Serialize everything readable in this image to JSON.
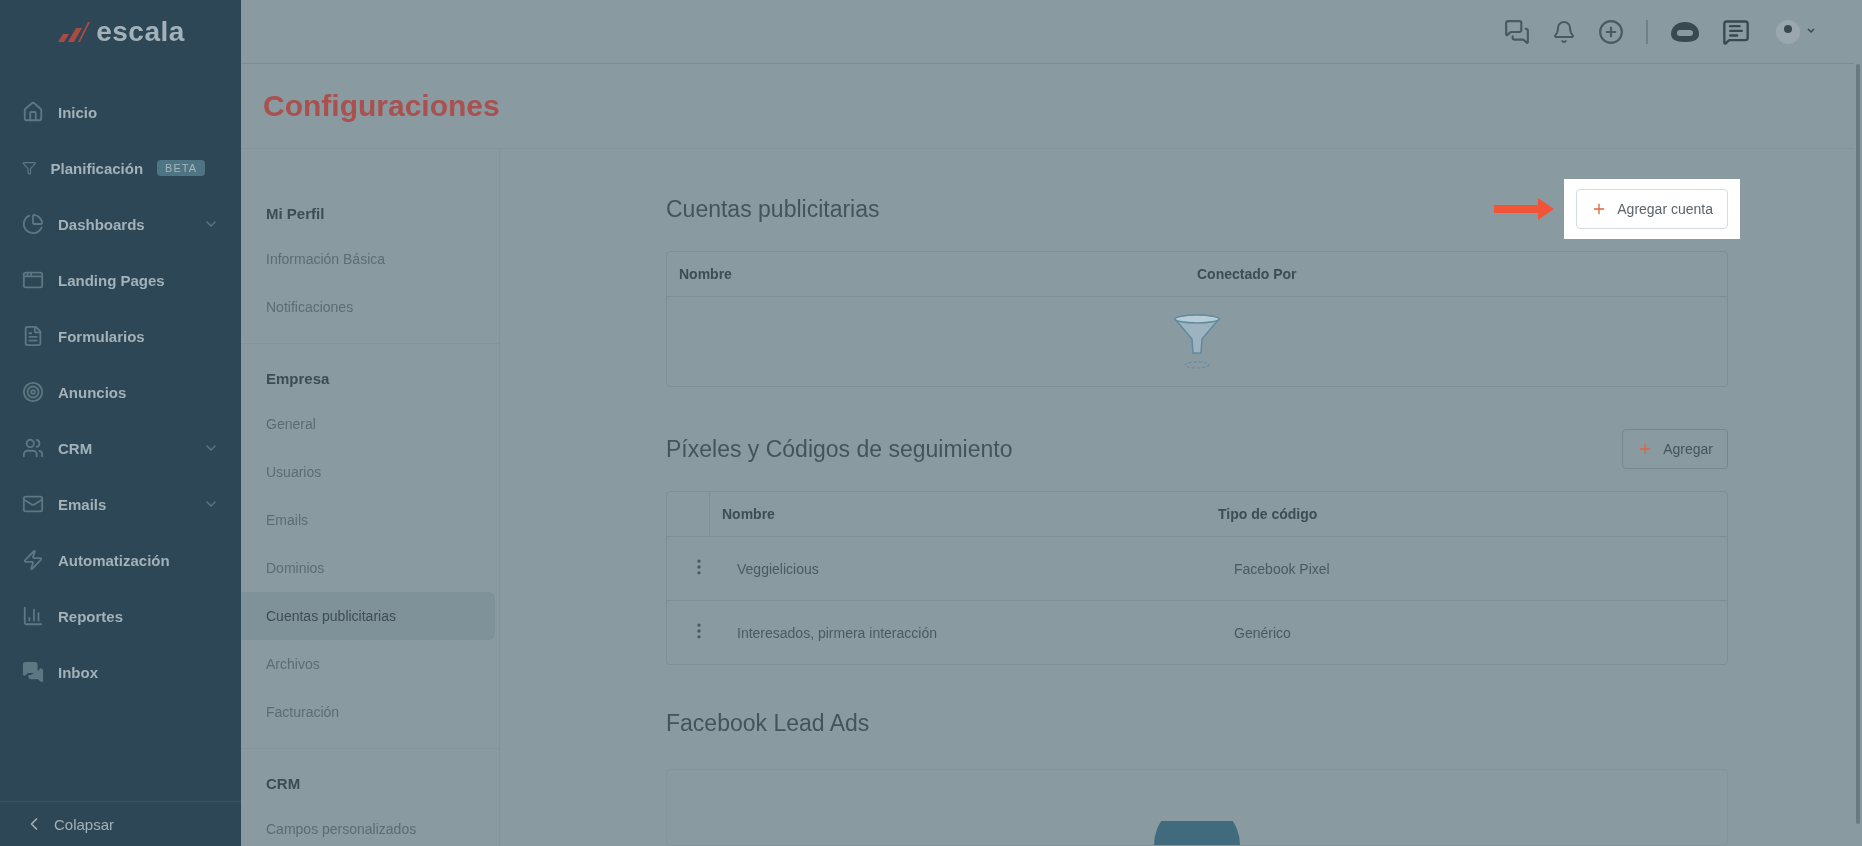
{
  "brand": {
    "name": "escala"
  },
  "sidebar": {
    "items": [
      {
        "label": "Inicio",
        "expandable": false
      },
      {
        "label": "Planificación",
        "badge": "BETA",
        "expandable": false
      },
      {
        "label": "Dashboards",
        "expandable": true
      },
      {
        "label": "Landing Pages",
        "expandable": false
      },
      {
        "label": "Formularios",
        "expandable": false
      },
      {
        "label": "Anuncios",
        "expandable": false
      },
      {
        "label": "CRM",
        "expandable": true
      },
      {
        "label": "Emails",
        "expandable": true
      },
      {
        "label": "Automatización",
        "expandable": false
      },
      {
        "label": "Reportes",
        "expandable": false
      },
      {
        "label": "Inbox",
        "expandable": false
      }
    ],
    "collapse": "Colapsar"
  },
  "page_title": "Configuraciones",
  "settings_menu": {
    "sections": [
      {
        "heading": "Mi Perfil",
        "items": [
          {
            "label": "Información Básica",
            "selected": false
          },
          {
            "label": "Notificaciones",
            "selected": false
          }
        ]
      },
      {
        "heading": "Empresa",
        "items": [
          {
            "label": "General",
            "selected": false
          },
          {
            "label": "Usuarios",
            "selected": false
          },
          {
            "label": "Emails",
            "selected": false
          },
          {
            "label": "Dominios",
            "selected": false
          },
          {
            "label": "Cuentas publicitarias",
            "selected": true
          },
          {
            "label": "Archivos",
            "selected": false
          },
          {
            "label": "Facturación",
            "selected": false
          }
        ]
      },
      {
        "heading": "CRM",
        "items": [
          {
            "label": "Campos personalizados",
            "selected": false
          }
        ]
      }
    ]
  },
  "sections": [
    {
      "kind": "table",
      "title": "Cuentas publicitarias",
      "button": {
        "label": "Agregar cuenta",
        "highlighted": true
      },
      "columns": [
        "Nombre",
        "Conectado Por"
      ],
      "menu_column": false
    },
    {
      "kind": "table",
      "title": "Píxeles y Códigos de seguimiento",
      "button": {
        "label": "Agregar",
        "highlighted": false
      },
      "columns": [
        "Nombre",
        "Tipo de código"
      ],
      "menu_column": true,
      "rows": [
        {
          "cells": [
            "Veggielicious",
            "Facebook Pixel"
          ]
        },
        {
          "cells": [
            "Interesados, pirmera interacción",
            "Genérico"
          ]
        }
      ]
    },
    {
      "kind": "card",
      "title": "Facebook Lead Ads"
    }
  ]
}
